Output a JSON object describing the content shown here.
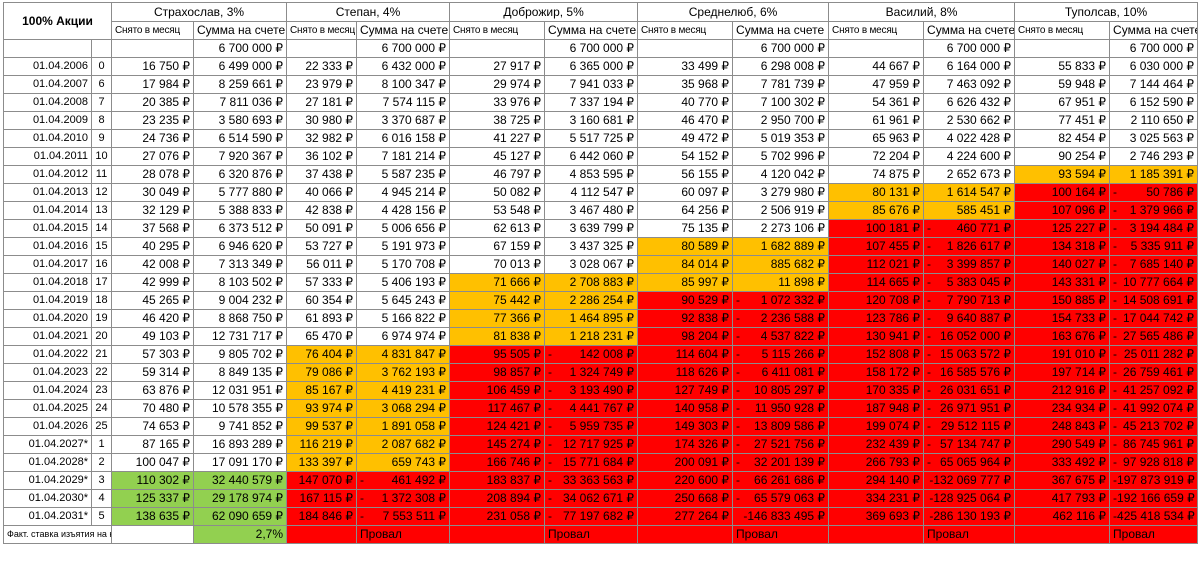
{
  "corner_label": "100% Акции",
  "col_withdrawn": "Снято в месяц",
  "col_balance": "Сумма на счете",
  "initial_balance": "6 700 000 ₽",
  "footer_label": "Факт. ставка изъятия на конец периода",
  "persons": [
    {
      "name": "Страхослав, 3%",
      "result": "2,7%"
    },
    {
      "name": "Степан, 4%",
      "result": "Провал"
    },
    {
      "name": "Доброжир, 5%",
      "result": "Провал"
    },
    {
      "name": "Среднелюб, 6%",
      "result": "Провал"
    },
    {
      "name": "Василий, 8%",
      "result": "Провал"
    },
    {
      "name": "Туполсав, 10%",
      "result": "Провал"
    }
  ],
  "rows": [
    {
      "date": "01.04.2006",
      "yr": "0",
      "cells": [
        [
          "16 750 ₽",
          "6 499 000 ₽"
        ],
        [
          "22 333 ₽",
          "6 432 000 ₽"
        ],
        [
          "27 917 ₽",
          "6 365 000 ₽"
        ],
        [
          "33 499 ₽",
          "6 298 008 ₽"
        ],
        [
          "44 667 ₽",
          "6 164 000 ₽"
        ],
        [
          "55 833 ₽",
          "6 030 000 ₽"
        ]
      ],
      "status": [
        "w",
        "w",
        "w",
        "w",
        "w",
        "w"
      ]
    },
    {
      "date": "01.04.2007",
      "yr": "6",
      "cells": [
        [
          "17 984 ₽",
          "8 259 661 ₽"
        ],
        [
          "23 979 ₽",
          "8 100 347 ₽"
        ],
        [
          "29 974 ₽",
          "7 941 033 ₽"
        ],
        [
          "35 968 ₽",
          "7 781 739 ₽"
        ],
        [
          "47 959 ₽",
          "7 463 092 ₽"
        ],
        [
          "59 948 ₽",
          "7 144 464 ₽"
        ]
      ],
      "status": [
        "w",
        "w",
        "w",
        "w",
        "w",
        "w"
      ]
    },
    {
      "date": "01.04.2008",
      "yr": "7",
      "cells": [
        [
          "20 385 ₽",
          "7 811 036 ₽"
        ],
        [
          "27 181 ₽",
          "7 574 115 ₽"
        ],
        [
          "33 976 ₽",
          "7 337 194 ₽"
        ],
        [
          "40 770 ₽",
          "7 100 302 ₽"
        ],
        [
          "54 361 ₽",
          "6 626 432 ₽"
        ],
        [
          "67 951 ₽",
          "6 152 590 ₽"
        ]
      ],
      "status": [
        "w",
        "w",
        "w",
        "w",
        "w",
        "w"
      ]
    },
    {
      "date": "01.04.2009",
      "yr": "8",
      "cells": [
        [
          "23 235 ₽",
          "3 580 693 ₽"
        ],
        [
          "30 980 ₽",
          "3 370 687 ₽"
        ],
        [
          "38 725 ₽",
          "3 160 681 ₽"
        ],
        [
          "46 470 ₽",
          "2 950 700 ₽"
        ],
        [
          "61 961 ₽",
          "2 530 662 ₽"
        ],
        [
          "77 451 ₽",
          "2 110 650 ₽"
        ]
      ],
      "status": [
        "w",
        "w",
        "w",
        "w",
        "w",
        "w"
      ]
    },
    {
      "date": "01.04.2010",
      "yr": "9",
      "cells": [
        [
          "24 736 ₽",
          "6 514 590 ₽"
        ],
        [
          "32 982 ₽",
          "6 016 158 ₽"
        ],
        [
          "41 227 ₽",
          "5 517 725 ₽"
        ],
        [
          "49 472 ₽",
          "5 019 353 ₽"
        ],
        [
          "65 963 ₽",
          "4 022 428 ₽"
        ],
        [
          "82 454 ₽",
          "3 025 563 ₽"
        ]
      ],
      "status": [
        "w",
        "w",
        "w",
        "w",
        "w",
        "w"
      ]
    },
    {
      "date": "01.04.2011",
      "yr": "10",
      "cells": [
        [
          "27 076 ₽",
          "7 920 367 ₽"
        ],
        [
          "36 102 ₽",
          "7 181 214 ₽"
        ],
        [
          "45 127 ₽",
          "6 442 060 ₽"
        ],
        [
          "54 152 ₽",
          "5 702 996 ₽"
        ],
        [
          "72 204 ₽",
          "4 224 600 ₽"
        ],
        [
          "90 254 ₽",
          "2 746 293 ₽"
        ]
      ],
      "status": [
        "w",
        "w",
        "w",
        "w",
        "w",
        "w"
      ]
    },
    {
      "date": "01.04.2012",
      "yr": "11",
      "cells": [
        [
          "28 078 ₽",
          "6 320 876 ₽"
        ],
        [
          "37 438 ₽",
          "5 587 235 ₽"
        ],
        [
          "46 797 ₽",
          "4 853 595 ₽"
        ],
        [
          "56 155 ₽",
          "4 120 042 ₽"
        ],
        [
          "74 875 ₽",
          "2 652 673 ₽"
        ],
        [
          "93 594 ₽",
          "1 185 391 ₽"
        ]
      ],
      "status": [
        "w",
        "w",
        "w",
        "w",
        "w",
        "a"
      ]
    },
    {
      "date": "01.04.2013",
      "yr": "12",
      "cells": [
        [
          "30 049 ₽",
          "5 777 880 ₽"
        ],
        [
          "40 066 ₽",
          "4 945 214 ₽"
        ],
        [
          "50 082 ₽",
          "4 112 547 ₽"
        ],
        [
          "60 097 ₽",
          "3 279 980 ₽"
        ],
        [
          "80 131 ₽",
          "1 614 547 ₽"
        ],
        [
          "100 164 ₽",
          "50 786 ₽"
        ]
      ],
      "status": [
        "w",
        "w",
        "w",
        "w",
        "a",
        "r"
      ]
    },
    {
      "date": "01.04.2014",
      "yr": "13",
      "cells": [
        [
          "32 129 ₽",
          "5 388 833 ₽"
        ],
        [
          "42 838 ₽",
          "4 428 156 ₽"
        ],
        [
          "53 548 ₽",
          "3 467 480 ₽"
        ],
        [
          "64 256 ₽",
          "2 506 919 ₽"
        ],
        [
          "85 676 ₽",
          "585 451 ₽"
        ],
        [
          "107 096 ₽",
          "1 379 966 ₽"
        ]
      ],
      "status": [
        "w",
        "w",
        "w",
        "w",
        "a",
        "r"
      ]
    },
    {
      "date": "01.04.2015",
      "yr": "14",
      "cells": [
        [
          "37 568 ₽",
          "6 373 512 ₽"
        ],
        [
          "50 091 ₽",
          "5 006 656 ₽"
        ],
        [
          "62 613 ₽",
          "3 639 799 ₽"
        ],
        [
          "75 135 ₽",
          "2 273 106 ₽"
        ],
        [
          "100 181 ₽",
          "460 771 ₽"
        ],
        [
          "125 227 ₽",
          "3 194 484 ₽"
        ]
      ],
      "status": [
        "w",
        "w",
        "w",
        "w",
        "r",
        "r"
      ]
    },
    {
      "date": "01.04.2016",
      "yr": "15",
      "cells": [
        [
          "40 295 ₽",
          "6 946 620 ₽"
        ],
        [
          "53 727 ₽",
          "5 191 973 ₽"
        ],
        [
          "67 159 ₽",
          "3 437 325 ₽"
        ],
        [
          "80 589 ₽",
          "1 682 889 ₽"
        ],
        [
          "107 455 ₽",
          "1 826 617 ₽"
        ],
        [
          "134 318 ₽",
          "5 335 911 ₽"
        ]
      ],
      "status": [
        "w",
        "w",
        "w",
        "a",
        "r",
        "r"
      ]
    },
    {
      "date": "01.04.2017",
      "yr": "16",
      "cells": [
        [
          "42 008 ₽",
          "7 313 349 ₽"
        ],
        [
          "56 011 ₽",
          "5 170 708 ₽"
        ],
        [
          "70 013 ₽",
          "3 028 067 ₽"
        ],
        [
          "84 014 ₽",
          "885 682 ₽"
        ],
        [
          "112 021 ₽",
          "3 399 857 ₽"
        ],
        [
          "140 027 ₽",
          "7 685 140 ₽"
        ]
      ],
      "status": [
        "w",
        "w",
        "w",
        "a",
        "r",
        "r"
      ]
    },
    {
      "date": "01.04.2018",
      "yr": "17",
      "cells": [
        [
          "42 999 ₽",
          "8 103 502 ₽"
        ],
        [
          "57 333 ₽",
          "5 406 193 ₽"
        ],
        [
          "71 666 ₽",
          "2 708 883 ₽"
        ],
        [
          "85 997 ₽",
          "11 898 ₽"
        ],
        [
          "114 665 ₽",
          "5 383 045 ₽"
        ],
        [
          "143 331 ₽",
          "10 777 664 ₽"
        ]
      ],
      "status": [
        "w",
        "w",
        "a",
        "a",
        "r",
        "r"
      ]
    },
    {
      "date": "01.04.2019",
      "yr": "18",
      "cells": [
        [
          "45 265 ₽",
          "9 004 232 ₽"
        ],
        [
          "60 354 ₽",
          "5 645 243 ₽"
        ],
        [
          "75 442 ₽",
          "2 286 254 ₽"
        ],
        [
          "90 529 ₽",
          "1 072 332 ₽"
        ],
        [
          "120 708 ₽",
          "7 790 713 ₽"
        ],
        [
          "150 885 ₽",
          "14 508 691 ₽"
        ]
      ],
      "status": [
        "w",
        "w",
        "a",
        "r",
        "r",
        "r"
      ]
    },
    {
      "date": "01.04.2020",
      "yr": "19",
      "cells": [
        [
          "46 420 ₽",
          "8 868 750 ₽"
        ],
        [
          "61 893 ₽",
          "5 166 822 ₽"
        ],
        [
          "77 366 ₽",
          "1 464 895 ₽"
        ],
        [
          "92 838 ₽",
          "2 236 588 ₽"
        ],
        [
          "123 786 ₽",
          "9 640 887 ₽"
        ],
        [
          "154 733 ₽",
          "17 044 742 ₽"
        ]
      ],
      "status": [
        "w",
        "w",
        "a",
        "r",
        "r",
        "r"
      ]
    },
    {
      "date": "01.04.2021",
      "yr": "20",
      "cells": [
        [
          "49 103 ₽",
          "12 731 717 ₽"
        ],
        [
          "65 470 ₽",
          "6 974 974 ₽"
        ],
        [
          "81 838 ₽",
          "1 218 231 ₽"
        ],
        [
          "98 204 ₽",
          "4 537 822 ₽"
        ],
        [
          "130 941 ₽",
          "16 052 000 ₽"
        ],
        [
          "163 676 ₽",
          "27 565 486 ₽"
        ]
      ],
      "status": [
        "w",
        "w",
        "a",
        "r",
        "r",
        "r"
      ]
    },
    {
      "date": "01.04.2022",
      "yr": "21",
      "cells": [
        [
          "57 303 ₽",
          "9 805 702 ₽"
        ],
        [
          "76 404 ₽",
          "4 831 847 ₽"
        ],
        [
          "95 505 ₽",
          "142 008 ₽"
        ],
        [
          "114 604 ₽",
          "5 115 266 ₽"
        ],
        [
          "152 808 ₽",
          "15 063 572 ₽"
        ],
        [
          "191 010 ₽",
          "25 011 282 ₽"
        ]
      ],
      "status": [
        "w",
        "a",
        "r",
        "r",
        "r",
        "r"
      ]
    },
    {
      "date": "01.04.2023",
      "yr": "22",
      "cells": [
        [
          "59 314 ₽",
          "8 849 135 ₽"
        ],
        [
          "79 086 ₽",
          "3 762 193 ₽"
        ],
        [
          "98 857 ₽",
          "1 324 749 ₽"
        ],
        [
          "118 626 ₽",
          "6 411 081 ₽"
        ],
        [
          "158 172 ₽",
          "16 585 576 ₽"
        ],
        [
          "197 714 ₽",
          "26 759 461 ₽"
        ]
      ],
      "status": [
        "w",
        "a",
        "r",
        "r",
        "r",
        "r"
      ]
    },
    {
      "date": "01.04.2024",
      "yr": "23",
      "cells": [
        [
          "63 876 ₽",
          "12 031 951 ₽"
        ],
        [
          "85 167 ₽",
          "4 419 231 ₽"
        ],
        [
          "106 459 ₽",
          "3 193 490 ₽"
        ],
        [
          "127 749 ₽",
          "10 805 297 ₽"
        ],
        [
          "170 335 ₽",
          "26 031 651 ₽"
        ],
        [
          "212 916 ₽",
          "41 257 092 ₽"
        ]
      ],
      "status": [
        "w",
        "a",
        "r",
        "r",
        "r",
        "r"
      ]
    },
    {
      "date": "01.04.2025",
      "yr": "24",
      "cells": [
        [
          "70 480 ₽",
          "10 578 355 ₽"
        ],
        [
          "93 974 ₽",
          "3 068 294 ₽"
        ],
        [
          "117 467 ₽",
          "4 441 767 ₽"
        ],
        [
          "140 958 ₽",
          "11 950 928 ₽"
        ],
        [
          "187 948 ₽",
          "26 971 951 ₽"
        ],
        [
          "234 934 ₽",
          "41 992 074 ₽"
        ]
      ],
      "status": [
        "w",
        "a",
        "r",
        "r",
        "r",
        "r"
      ]
    },
    {
      "date": "01.04.2026",
      "yr": "25",
      "cells": [
        [
          "74 653 ₽",
          "9 741 852 ₽"
        ],
        [
          "99 537 ₽",
          "1 891 058 ₽"
        ],
        [
          "124 421 ₽",
          "5 959 735 ₽"
        ],
        [
          "149 303 ₽",
          "13 809 586 ₽"
        ],
        [
          "199 074 ₽",
          "29 512 115 ₽"
        ],
        [
          "248 843 ₽",
          "45 213 702 ₽"
        ]
      ],
      "status": [
        "w",
        "a",
        "r",
        "r",
        "r",
        "r"
      ]
    },
    {
      "date": "01.04.2027*",
      "yr": "1",
      "cells": [
        [
          "87 165 ₽",
          "16 893 289 ₽"
        ],
        [
          "116 219 ₽",
          "2 087 682 ₽"
        ],
        [
          "145 274 ₽",
          "12 717 925 ₽"
        ],
        [
          "174 326 ₽",
          "27 521 756 ₽"
        ],
        [
          "232 439 ₽",
          "57 134 747 ₽"
        ],
        [
          "290 549 ₽",
          "86 745 961 ₽"
        ]
      ],
      "status": [
        "w",
        "a",
        "r",
        "r",
        "r",
        "r"
      ]
    },
    {
      "date": "01.04.2028*",
      "yr": "2",
      "cells": [
        [
          "100 047 ₽",
          "17 091 170 ₽"
        ],
        [
          "133 397 ₽",
          "659 743 ₽"
        ],
        [
          "166 746 ₽",
          "15 771 684 ₽"
        ],
        [
          "200 091 ₽",
          "32 201 139 ₽"
        ],
        [
          "266 793 ₽",
          "65 065 964 ₽"
        ],
        [
          "333 492 ₽",
          "97 928 818 ₽"
        ]
      ],
      "status": [
        "w",
        "a",
        "r",
        "r",
        "r",
        "r"
      ]
    },
    {
      "date": "01.04.2029*",
      "yr": "3",
      "cells": [
        [
          "110 302 ₽",
          "32 440 579 ₽"
        ],
        [
          "147 070 ₽",
          "461 492 ₽"
        ],
        [
          "183 837 ₽",
          "33 363 563 ₽"
        ],
        [
          "220 600 ₽",
          "66 261 686 ₽"
        ],
        [
          "294 140 ₽",
          "-132 069 777 ₽"
        ],
        [
          "367 675 ₽",
          "-197 873 919 ₽"
        ]
      ],
      "status": [
        "g",
        "r",
        "r",
        "r",
        "r",
        "r"
      ]
    },
    {
      "date": "01.04.2030*",
      "yr": "4",
      "cells": [
        [
          "125 337 ₽",
          "29 178 974 ₽"
        ],
        [
          "167 115 ₽",
          "1 372 308 ₽"
        ],
        [
          "208 894 ₽",
          "34 062 671 ₽"
        ],
        [
          "250 668 ₽",
          "65 579 063 ₽"
        ],
        [
          "334 231 ₽",
          "-128 925 064 ₽"
        ],
        [
          "417 793 ₽",
          "-192 166 659 ₽"
        ]
      ],
      "status": [
        "g",
        "r",
        "r",
        "r",
        "r",
        "r"
      ]
    },
    {
      "date": "01.04.2031*",
      "yr": "5",
      "cells": [
        [
          "138 635 ₽",
          "62 090 659 ₽"
        ],
        [
          "184 846 ₽",
          "7 553 511 ₽"
        ],
        [
          "231 058 ₽",
          "77 197 682 ₽"
        ],
        [
          "277 264 ₽",
          "-146 833 495 ₽"
        ],
        [
          "369 693 ₽",
          "-286 130 193 ₽"
        ],
        [
          "462 116 ₽",
          "-425 418 534 ₽"
        ]
      ],
      "status": [
        "g",
        "r",
        "r",
        "r",
        "r",
        "r"
      ]
    }
  ]
}
